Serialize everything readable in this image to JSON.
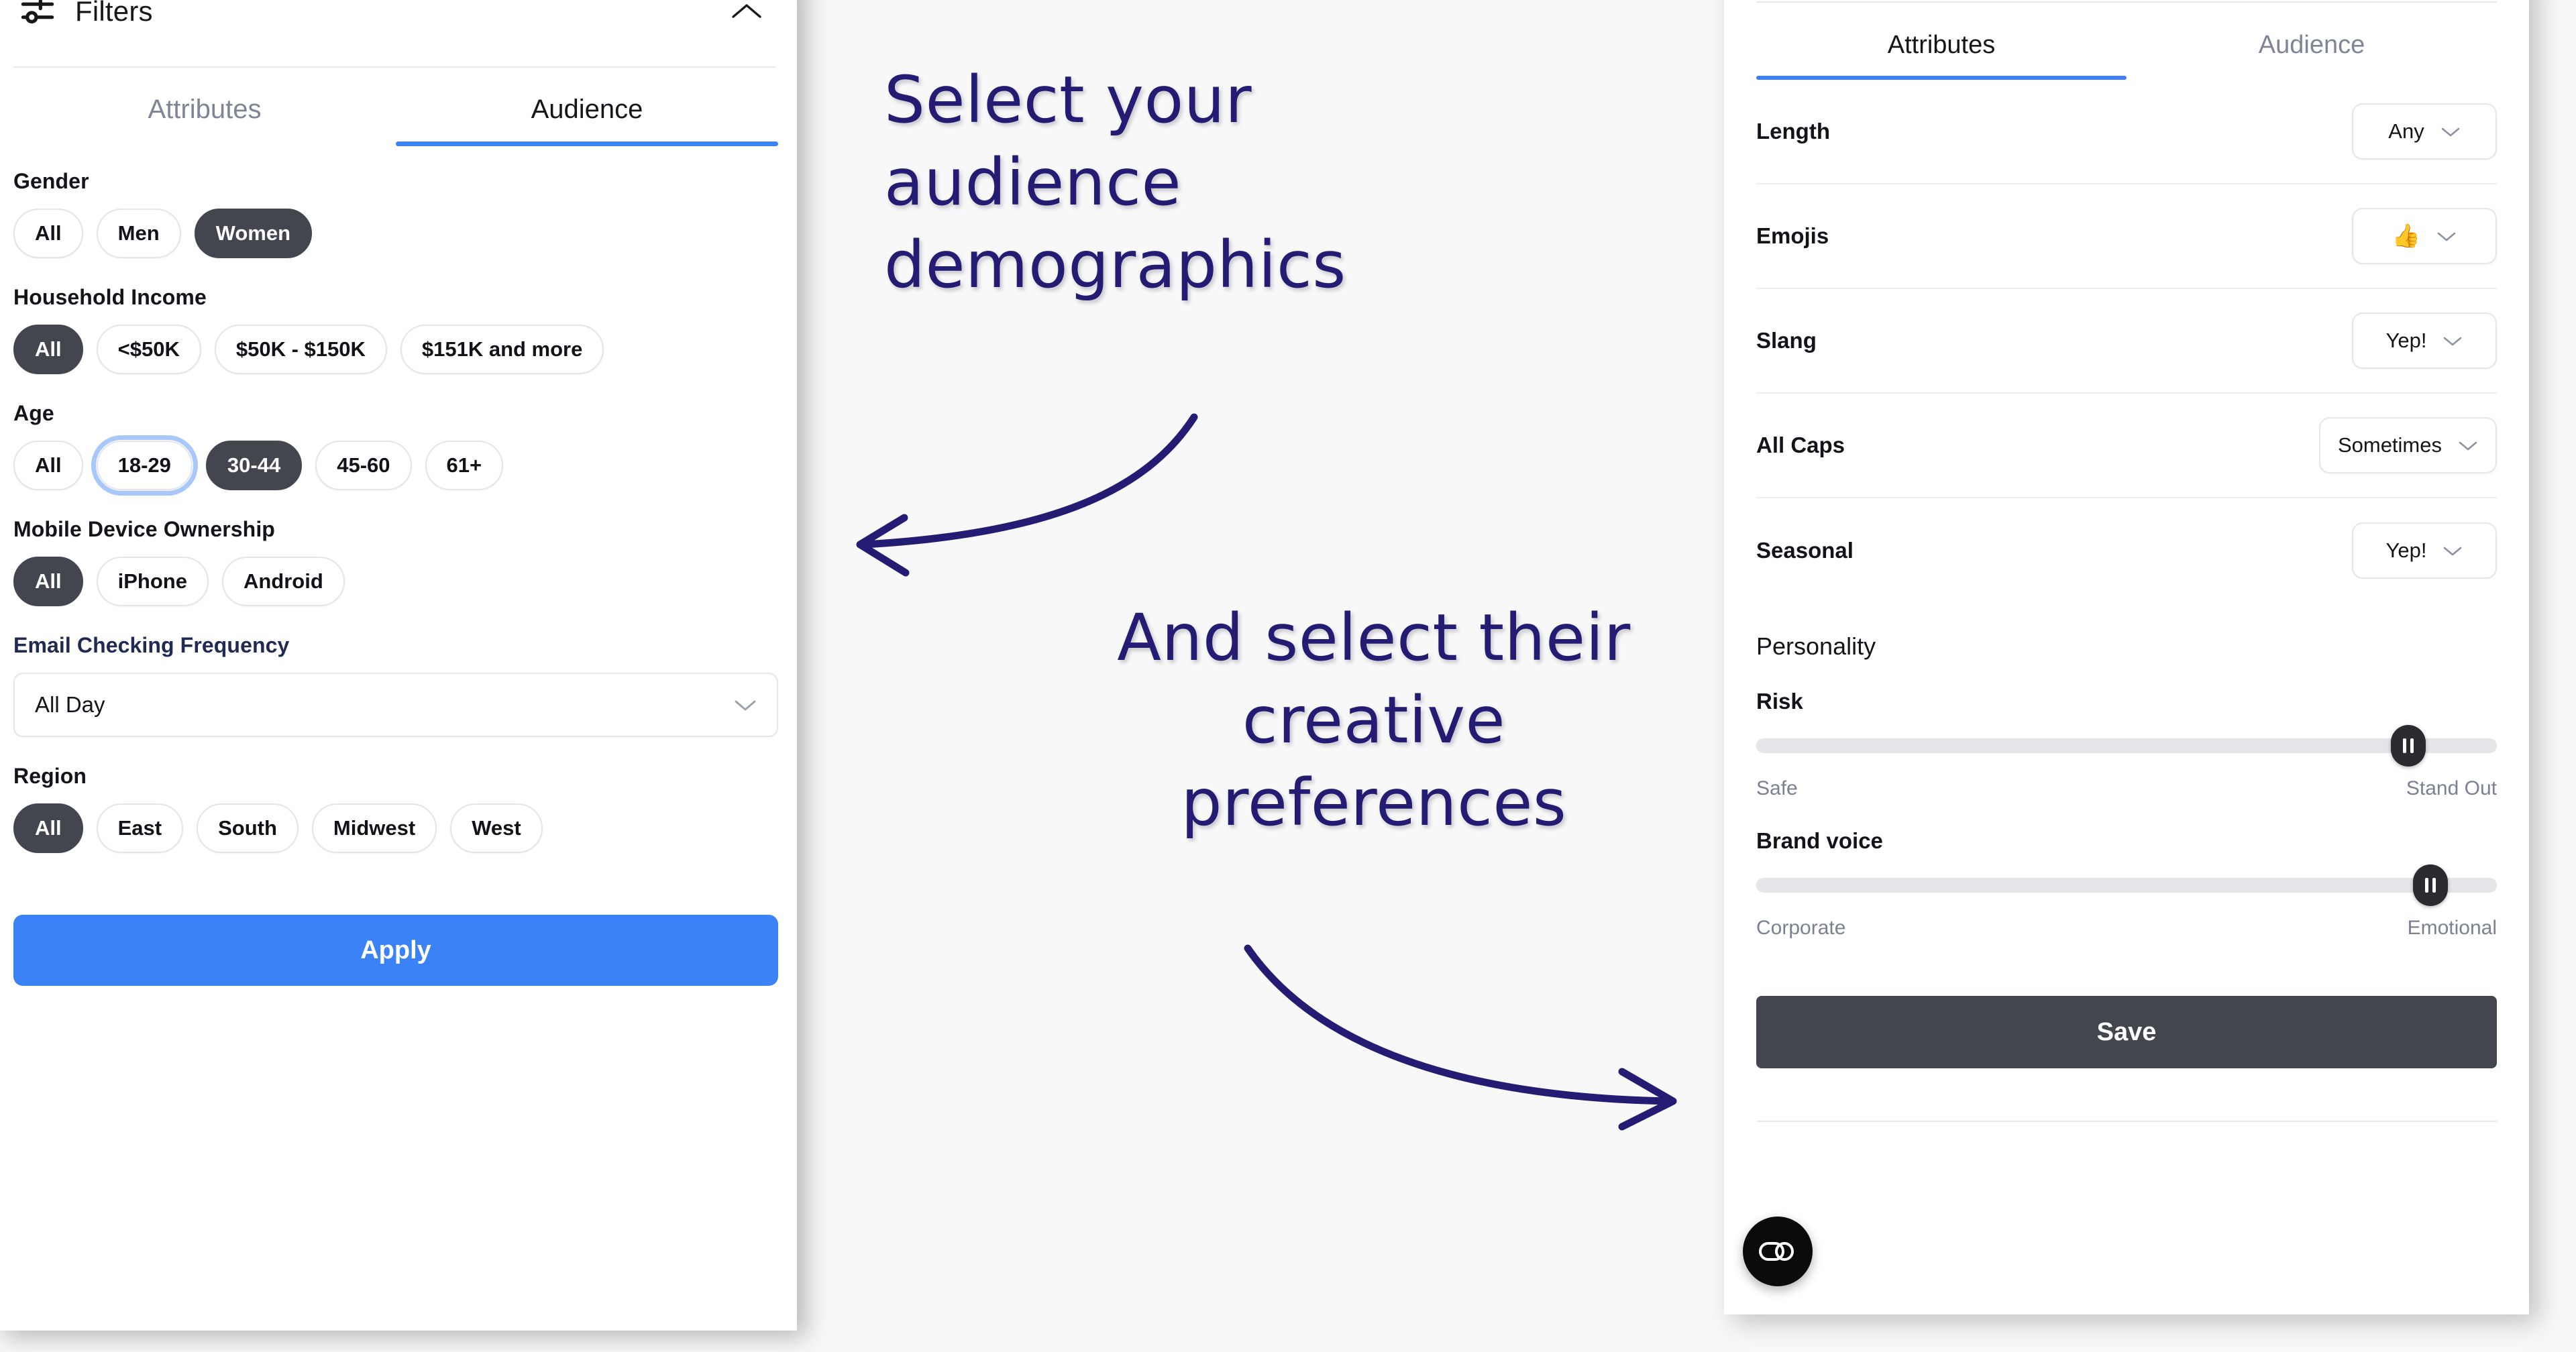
{
  "theme": {
    "accent_blue": "#3b82f6",
    "selected_dark": "#43454f",
    "annotation_purple": "#241c72",
    "muted_text": "#7b8193",
    "focus_ring": "#a8c7fa"
  },
  "filters_panel": {
    "title": "Filters",
    "icon": "sliders-icon",
    "collapse_icon": "chevron-up-icon",
    "tabs": [
      {
        "label": "Attributes",
        "active": false
      },
      {
        "label": "Audience",
        "active": true
      }
    ],
    "groups": [
      {
        "label": "Gender",
        "options": [
          {
            "label": "All",
            "selected": false
          },
          {
            "label": "Men",
            "selected": false
          },
          {
            "label": "Women",
            "selected": true
          }
        ]
      },
      {
        "label": "Household Income",
        "options": [
          {
            "label": "All",
            "selected": true
          },
          {
            "label": "<$50K",
            "selected": false
          },
          {
            "label": "$50K - $150K",
            "selected": false
          },
          {
            "label": "$151K and more",
            "selected": false
          }
        ]
      },
      {
        "label": "Age",
        "options": [
          {
            "label": "All",
            "selected": false
          },
          {
            "label": "18-29",
            "selected": false,
            "focused": true
          },
          {
            "label": "30-44",
            "selected": true
          },
          {
            "label": "45-60",
            "selected": false
          },
          {
            "label": "61+",
            "selected": false
          }
        ]
      },
      {
        "label": "Mobile Device Ownership",
        "options": [
          {
            "label": "All",
            "selected": true
          },
          {
            "label": "iPhone",
            "selected": false
          },
          {
            "label": "Android",
            "selected": false
          }
        ]
      }
    ],
    "email_frequency": {
      "label": "Email Checking Frequency",
      "value": "All Day",
      "chevron": "chevron-down-icon"
    },
    "region": {
      "label": "Region",
      "options": [
        {
          "label": "All",
          "selected": true
        },
        {
          "label": "East",
          "selected": false
        },
        {
          "label": "South",
          "selected": false
        },
        {
          "label": "Midwest",
          "selected": false
        },
        {
          "label": "West",
          "selected": false
        }
      ]
    },
    "apply_label": "Apply"
  },
  "attributes_panel": {
    "tabs": [
      {
        "label": "Attributes",
        "active": true
      },
      {
        "label": "Audience",
        "active": false
      }
    ],
    "rows": [
      {
        "label": "Length",
        "value": "Any",
        "emoji": ""
      },
      {
        "label": "Emojis",
        "value": "",
        "emoji": "👍"
      },
      {
        "label": "Slang",
        "value": "Yep!",
        "emoji": ""
      },
      {
        "label": "All Caps",
        "value": "Sometimes",
        "emoji": ""
      },
      {
        "label": "Seasonal",
        "value": "Yep!",
        "emoji": ""
      }
    ],
    "personality_title": "Personality",
    "sliders": [
      {
        "label": "Risk",
        "min_label": "Safe",
        "max_label": "Stand Out",
        "value_pct": 88
      },
      {
        "label": "Brand voice",
        "min_label": "Corporate",
        "max_label": "Emotional",
        "value_pct": 91
      }
    ],
    "save_label": "Save"
  },
  "accessibility_badge": {
    "icon": "accessibility-toggle-icon"
  },
  "annotations": [
    {
      "id": "anno-1",
      "text": "Select your audience demographics",
      "direction": "left"
    },
    {
      "id": "anno-2",
      "text": "And select their creative preferences",
      "direction": "right"
    }
  ]
}
